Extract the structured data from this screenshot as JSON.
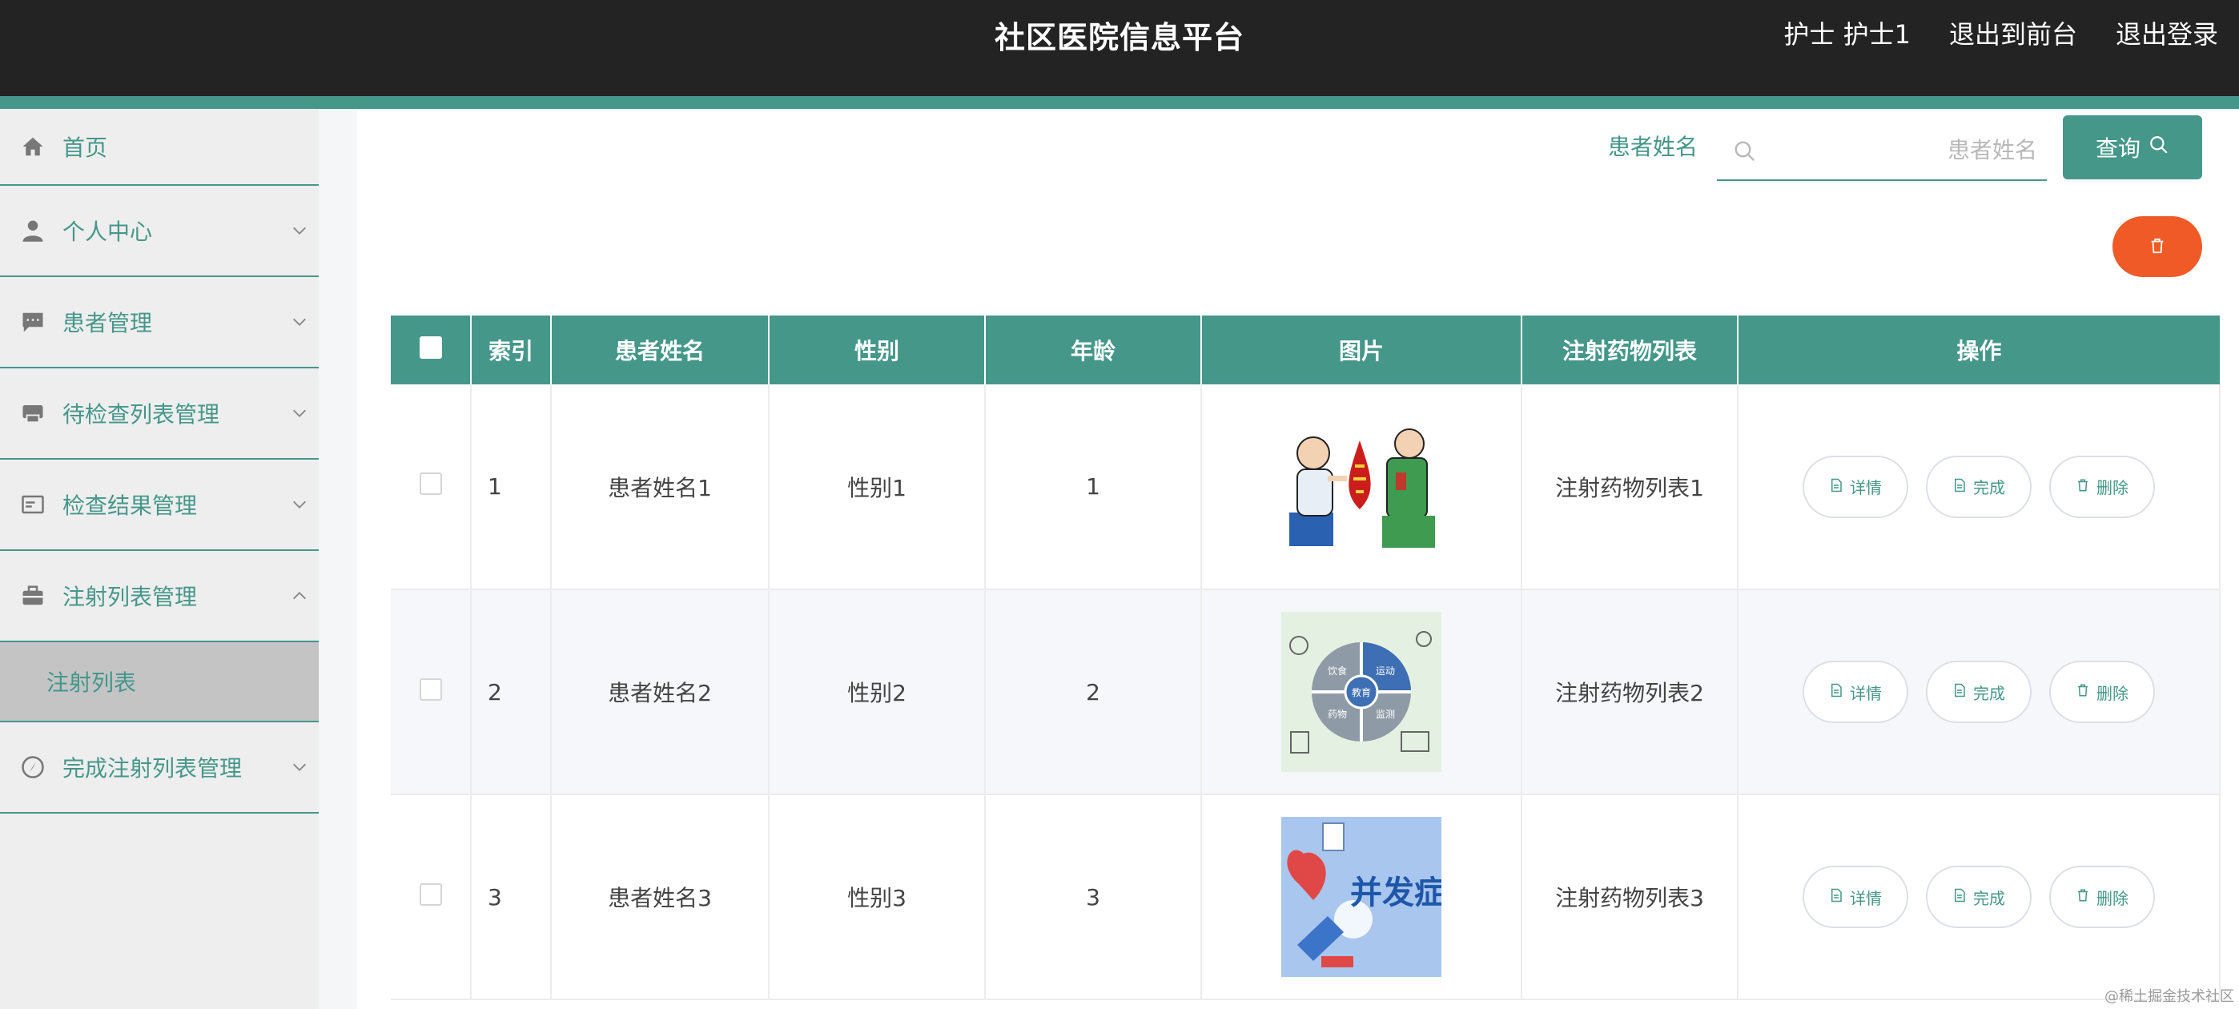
{
  "header": {
    "title": "社区医院信息平台",
    "user": "护士 护士1",
    "front_link": "退出到前台",
    "logout_link": "退出登录"
  },
  "sidebar": {
    "items": [
      {
        "label": "首页",
        "icon": "home-icon"
      },
      {
        "label": "个人中心",
        "icon": "user-icon"
      },
      {
        "label": "患者管理",
        "icon": "message-icon"
      },
      {
        "label": "待检查列表管理",
        "icon": "printer-icon"
      },
      {
        "label": "检查结果管理",
        "icon": "id-card-icon"
      },
      {
        "label": "注射列表管理",
        "icon": "briefcase-icon"
      },
      {
        "label": "完成注射列表管理",
        "icon": "compass-icon"
      }
    ],
    "active_sub": "注射列表"
  },
  "search": {
    "label": "患者姓名",
    "placeholder": "患者姓名",
    "value": "",
    "button": "查询"
  },
  "table": {
    "headers": [
      "索引",
      "患者姓名",
      "性别",
      "年龄",
      "图片",
      "注射药物列表",
      "操作"
    ],
    "rows": [
      {
        "index": "1",
        "name": "患者姓名1",
        "gender": "性别1",
        "age": "1",
        "drugs": "注射药物列表1"
      },
      {
        "index": "2",
        "name": "患者姓名2",
        "gender": "性别2",
        "age": "2",
        "drugs": "注射药物列表2"
      },
      {
        "index": "3",
        "name": "患者姓名3",
        "gender": "性别3",
        "age": "3",
        "drugs": "注射药物列表3"
      }
    ],
    "actions": {
      "detail": "详情",
      "complete": "完成",
      "delete": "删除"
    },
    "thumb_texts": {
      "edu_center": "教育",
      "edu_q1": "饮食",
      "edu_q2": "运动",
      "edu_q3": "药物",
      "edu_q4": "监测",
      "complication": "并发症"
    }
  },
  "watermark": "@稀土掘金技术社区",
  "colors": {
    "accent": "#45978a",
    "danger": "#f05a27",
    "header_bg": "#232323"
  }
}
